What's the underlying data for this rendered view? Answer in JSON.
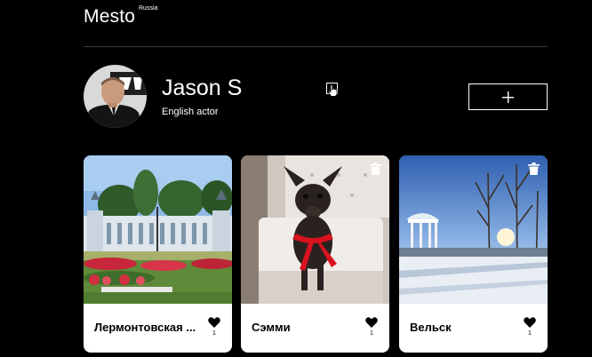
{
  "header": {
    "logo": "Mesto",
    "logo_sup": "Russia"
  },
  "profile": {
    "name": "Jason S",
    "about": "English actor"
  },
  "cards": [
    {
      "title": "Лермонтовская ...",
      "likes": "1"
    },
    {
      "title": "Сэмми",
      "likes": "1"
    },
    {
      "title": "Вельск",
      "likes": "1"
    }
  ],
  "colors": {
    "background": "#000000",
    "text": "#ffffff",
    "card": "#ffffff",
    "card_text": "#000000"
  },
  "icons": {
    "edit": "pencil-icon",
    "add": "plus-icon",
    "delete": "trash-icon",
    "like": "heart-icon"
  }
}
